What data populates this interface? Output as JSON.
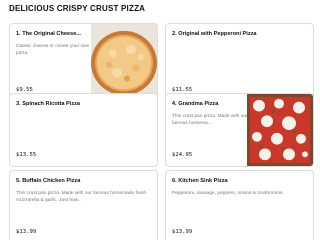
{
  "section": {
    "title": "DELICIOUS CRISPY CRUST PIZZA"
  },
  "items": [
    {
      "name": "1. The Original Cheese...",
      "description": "Classic cheese or create your own pizza.",
      "price": "$9.55",
      "image": "cheese-pizza-image"
    },
    {
      "name": "2. Original with Pepperoni Pizza",
      "description": "",
      "price": "$11.55"
    },
    {
      "name": "3. Spinach Ricotta Pizza",
      "description": "",
      "price": "$13.55"
    },
    {
      "name": "4. Grandma Pizza",
      "description": "Thin crust pan pizza. Made with our famous homema...",
      "price": "$24.95",
      "image": "grandma-pizza-image"
    },
    {
      "name": "5. Buffalo Chicken Pizza",
      "description": "Thin crust pan pizza. Made with our famous homemade fresh mozzarella & garlic. Just how...",
      "price": "$13.99"
    },
    {
      "name": "6. Kitchen Sink Pizza",
      "description": "Pepperoni, sausage, peppers, onions & mushrooms.",
      "price": "$13.99"
    }
  ]
}
